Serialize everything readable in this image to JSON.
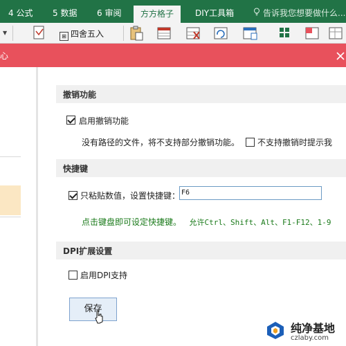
{
  "ribbon": {
    "tabs": [
      {
        "label": "4 公式",
        "active": false
      },
      {
        "label": "5 数据",
        "active": false
      },
      {
        "label": "6 审阅",
        "active": false
      },
      {
        "label": "方方格子",
        "active": true
      },
      {
        "label": "DIY工具箱",
        "active": false
      }
    ],
    "tell_me": "告诉我您想要做什么...",
    "round_label": "四舍五入",
    "accent": "#217346"
  },
  "dialog": {
    "title_fragment": "心",
    "title_bar_color": "#e8515c",
    "undo_section": {
      "title": "撤销功能",
      "enable_undo": {
        "label": "启用撤销功能",
        "checked": true
      },
      "note": "没有路径的文件，将不支持部分撤销功能。",
      "no_prompt": {
        "label": "不支持撤销时提示我",
        "checked": false
      }
    },
    "hotkey_section": {
      "title": "快捷键",
      "paste_values": {
        "label": "只粘贴数值，设置快捷键：",
        "checked": true
      },
      "hotkey_value": "F6",
      "hint_prefix": "点击键盘即可设定快捷键。",
      "hint_allowed": "允许Ctrl、Shift、Alt、F1-F12、1-9"
    },
    "dpi_section": {
      "title": "DPI扩展设置",
      "enable_dpi": {
        "label": "启用DPI支持",
        "checked": false
      }
    },
    "save_button": "保存"
  },
  "watermark": {
    "title": "纯净基地",
    "url": "czlaby.com"
  }
}
